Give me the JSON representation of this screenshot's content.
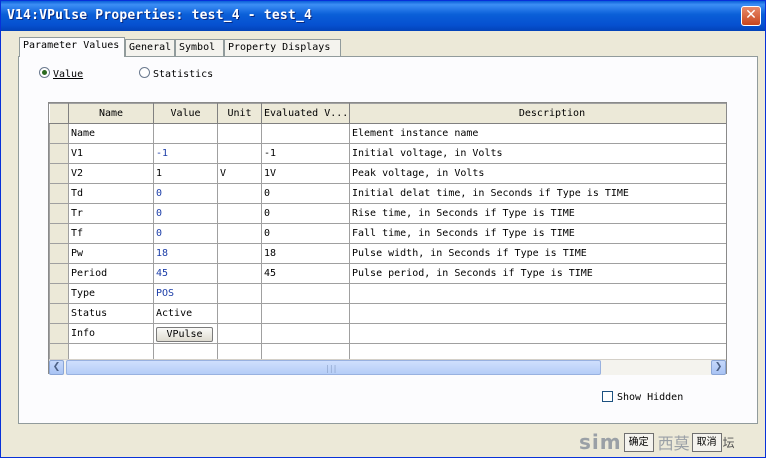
{
  "window": {
    "title": "V14:VPulse Properties: test_4 - test_4",
    "close_glyph": "✕"
  },
  "tabs": [
    "Parameter Values",
    "General",
    "Symbol",
    "Property Displays"
  ],
  "mode": {
    "value_label": "Value",
    "statistics_label": "Statistics",
    "selected": "Value"
  },
  "table": {
    "columns": [
      "Name",
      "Value",
      "Unit",
      "Evaluated V...",
      "Description"
    ],
    "rows": [
      {
        "name": "Name",
        "value": "",
        "unit": "",
        "evaluated": "",
        "description": "Element instance name"
      },
      {
        "name": "V1",
        "value": "-1",
        "unit": "",
        "evaluated": "-1",
        "description": "Initial voltage, in Volts"
      },
      {
        "name": "V2",
        "value": "1",
        "unit": "V",
        "evaluated": "1V",
        "description": "Peak voltage, in Volts"
      },
      {
        "name": "Td",
        "value": "0",
        "unit": "",
        "evaluated": "0",
        "description": "Initial delat time, in Seconds if Type is TIME"
      },
      {
        "name": "Tr",
        "value": "0",
        "unit": "",
        "evaluated": "0",
        "description": "Rise time, in Seconds if Type is TIME"
      },
      {
        "name": "Tf",
        "value": "0",
        "unit": "",
        "evaluated": "0",
        "description": "Fall time, in Seconds if Type is TIME"
      },
      {
        "name": "Pw",
        "value": "18",
        "unit": "",
        "evaluated": "18",
        "description": "Pulse width, in Seconds if Type is TIME"
      },
      {
        "name": "Period",
        "value": "45",
        "unit": "",
        "evaluated": "45",
        "description": "Pulse period, in Seconds if Type is TIME"
      },
      {
        "name": "Type",
        "value": "POS",
        "unit": "",
        "evaluated": "",
        "description": ""
      },
      {
        "name": "Status",
        "value": "Active",
        "unit": "",
        "evaluated": "",
        "description": ""
      },
      {
        "name": "Info",
        "value": "VPulse",
        "unit": "",
        "evaluated": "",
        "description": ""
      }
    ]
  },
  "show_hidden": {
    "label": "Show Hidden",
    "checked": false
  },
  "watermark": {
    "text": "sim",
    "btn1": "确定",
    "chars": "西莫",
    "btn2": "取消",
    "suffix": "坛"
  },
  "colors": {
    "title_bar": "#0a5fd8",
    "value_text": "#1c3ea8",
    "close_button": "#c8441c"
  }
}
